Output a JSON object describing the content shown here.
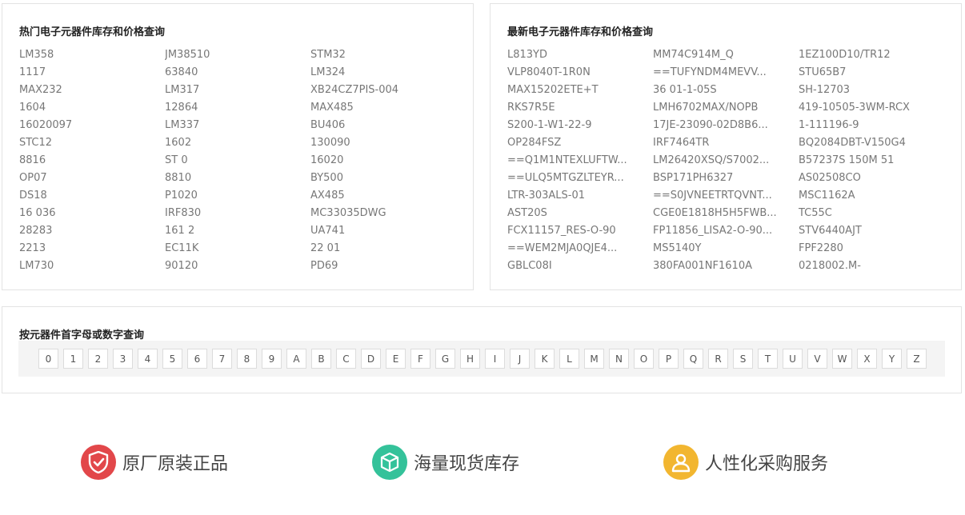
{
  "hot": {
    "title": "热门电子元器件库存和价格查询",
    "parts": [
      "LM358",
      "JM38510",
      "STM32",
      "1117",
      "63840",
      "LM324",
      "MAX232",
      "LM317",
      "XB24CZ7PIS-004",
      "1604",
      "12864",
      "MAX485",
      "16020097",
      "LM337",
      "BU406",
      "STC12",
      "1602",
      "130090",
      "8816",
      "ST 0",
      "16020",
      "OP07",
      "8810",
      "BY500",
      "DS18",
      "P1020",
      "AX485",
      "16 036",
      "IRF830",
      "MC33035DWG",
      "28283",
      "161 2",
      "UA741",
      "2213",
      "EC11K",
      "22 01",
      "LM730",
      "90120",
      "PD69"
    ]
  },
  "latest": {
    "title": "最新电子元器件库存和价格查询",
    "parts": [
      "L813YD",
      "MM74C914M_Q",
      "1EZ100D10/TR12",
      "VLP8040T-1R0N",
      "==TUFYNDM4MEVV...",
      "STU65B7",
      "MAX15202ETE+T",
      "36 01-1-05S",
      "SH-12703",
      "RKS7R5E",
      "LMH6702MAX/NOPB",
      "419-10505-3WM-RCX",
      "S200-1-W1-22-9",
      "17JE-23090-02D8B6...",
      "1-111196-9",
      "OP284FSZ",
      "IRF7464TR",
      "BQ2084DBT-V150G4",
      "==Q1M1NTEXLUFTW...",
      "LM26420XSQ/S7002...",
      "B57237S 150M 51",
      "==ULQ5MTGZLTEYR...",
      "BSP171PH6327",
      "AS02508CO",
      "LTR-303ALS-01",
      "==S0JVNEETRTQVNT...",
      "MSC1162A",
      "AST20S",
      "CGE0E1818H5H5FWB...",
      "TC55C",
      "FCX11157_RES-O-90",
      "FP11856_LISA2-O-90...",
      "STV6440AJT",
      "==WEM2MJA0QJE4...",
      "MS5140Y",
      "FPF2280",
      "GBLC08I",
      "380FA001NF1610A",
      "0218002.M-"
    ]
  },
  "index": {
    "title": "按元器件首字母或数字查询",
    "letters": [
      "0",
      "1",
      "2",
      "3",
      "4",
      "5",
      "6",
      "7",
      "8",
      "9",
      "A",
      "B",
      "C",
      "D",
      "E",
      "F",
      "G",
      "H",
      "I",
      "J",
      "K",
      "L",
      "M",
      "N",
      "O",
      "P",
      "Q",
      "R",
      "S",
      "T",
      "U",
      "V",
      "W",
      "X",
      "Y",
      "Z"
    ]
  },
  "features": [
    {
      "label": "原厂原装正品",
      "icon": "shield-check-icon",
      "color": "#e2474a"
    },
    {
      "label": "海量现货库存",
      "icon": "box-icon",
      "color": "#34c29a"
    },
    {
      "label": "人性化采购服务",
      "icon": "user-icon",
      "color": "#f2b630"
    }
  ]
}
